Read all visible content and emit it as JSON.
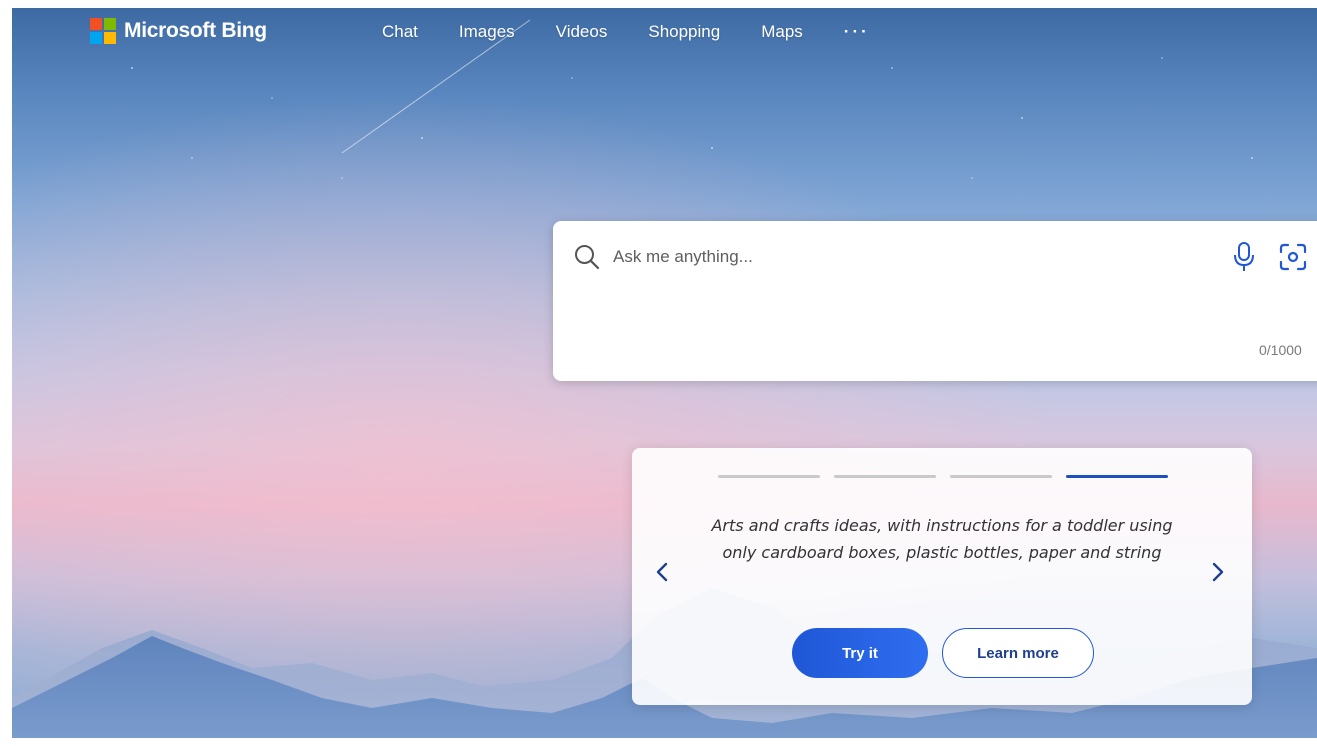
{
  "header": {
    "logo_text": "Microsoft Bing",
    "nav": [
      {
        "label": "Chat"
      },
      {
        "label": "Images"
      },
      {
        "label": "Videos"
      },
      {
        "label": "Shopping"
      },
      {
        "label": "Maps"
      }
    ],
    "more_label": "···"
  },
  "search": {
    "placeholder": "Ask me anything...",
    "value": "",
    "char_count": "0/1000"
  },
  "suggestion_card": {
    "text": "Arts and crafts ideas, with instructions for a toddler using only cardboard boxes, plastic bottles, paper and string",
    "steps_total": 4,
    "active_step": 4,
    "try_label": "Try it",
    "learn_label": "Learn more"
  },
  "colors": {
    "logo_red": "#f25022",
    "logo_green": "#7fba00",
    "logo_blue": "#00a4ef",
    "logo_yellow": "#ffb900",
    "accent_blue": "#1f57d6"
  },
  "icons": {
    "search": "search-icon",
    "mic": "microphone-icon",
    "visual_search": "visual-search-icon",
    "prev": "chevron-left-icon",
    "next": "chevron-right-icon"
  }
}
